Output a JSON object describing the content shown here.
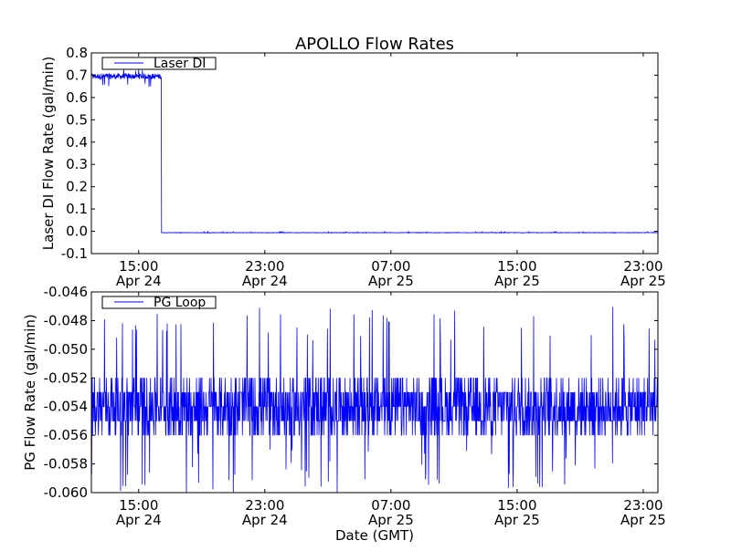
{
  "chart_data": {
    "type": "line",
    "title": "APOLLO Flow Rates",
    "xlabel": "Date (GMT)",
    "x_units": "hours since Apr 24 00:00 GMT",
    "xlim": [
      12.0,
      47.93
    ],
    "xticks": [
      {
        "value": 15,
        "label_time": "15:00",
        "label_date": "Apr 24"
      },
      {
        "value": 23,
        "label_time": "23:00",
        "label_date": "Apr 24"
      },
      {
        "value": 31,
        "label_time": "07:00",
        "label_date": "Apr 25"
      },
      {
        "value": 39,
        "label_time": "15:00",
        "label_date": "Apr 25"
      },
      {
        "value": 47,
        "label_time": "23:00",
        "label_date": "Apr 25"
      }
    ],
    "subplots": [
      {
        "ylabel": "Laser DI Flow Rate (gal/min)",
        "ylim": [
          -0.1,
          0.8
        ],
        "yticks": [
          "-0.1",
          "0.0",
          "0.1",
          "0.2",
          "0.3",
          "0.4",
          "0.5",
          "0.6",
          "0.7",
          "0.8"
        ],
        "legend": {
          "label": "Laser DI",
          "position": "top-left"
        },
        "series": [
          {
            "name": "Laser DI",
            "color": "#0000ff",
            "segments": [
              {
                "x_start": 12.0,
                "x_end": 16.45,
                "mean": 0.695,
                "noise": 0.012,
                "min_spike": 0.645,
                "max_spike": 0.73
              },
              {
                "x_start": 16.45,
                "x_end": 47.93,
                "mean": -0.006,
                "noise": 0.001,
                "min_spike": -0.008,
                "max_spike": -0.002
              }
            ]
          }
        ]
      },
      {
        "ylabel": "PG Flow Rate (gal/min)",
        "ylim": [
          -0.06,
          -0.046
        ],
        "yticks": [
          "-0.060",
          "-0.058",
          "-0.056",
          "-0.054",
          "-0.052",
          "-0.050",
          "-0.048",
          "-0.046"
        ],
        "legend": {
          "label": "PG Loop",
          "position": "top-left"
        },
        "series": [
          {
            "name": "PG Loop",
            "color": "#0000ff",
            "segments": [
              {
                "x_start": 12.0,
                "x_end": 47.93,
                "mean": -0.054,
                "band": [
                  -0.056,
                  -0.052
                ],
                "min_spike": -0.06,
                "max_spike": -0.047
              }
            ]
          }
        ]
      }
    ]
  }
}
